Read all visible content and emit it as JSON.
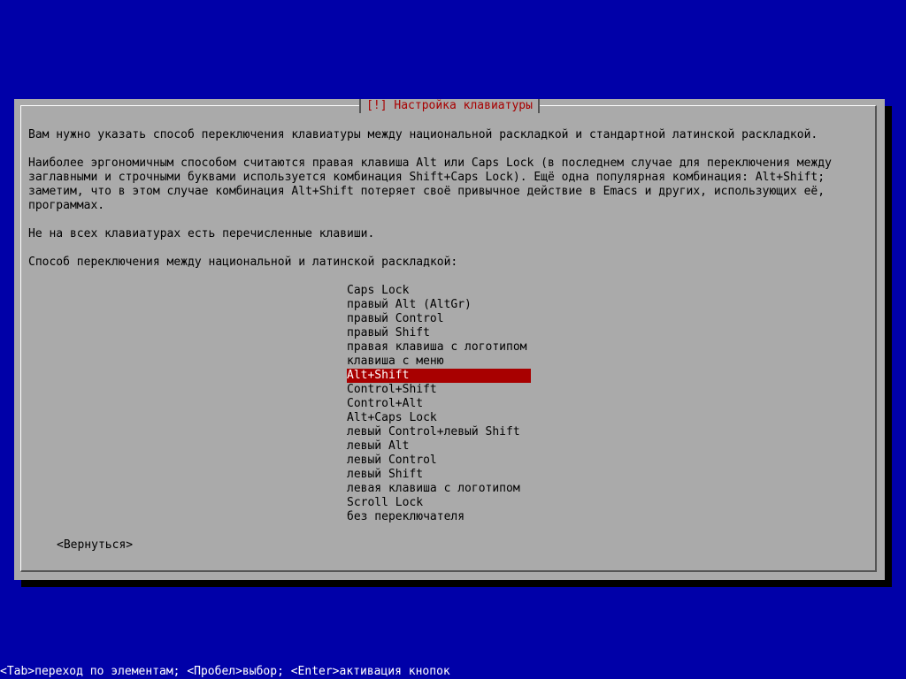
{
  "dialog": {
    "title": "[!] Настройка клавиатуры",
    "paragraph1": "Вам нужно указать способ переключения клавиатуры между национальной раскладкой и стандартной латинской раскладкой.",
    "paragraph2_line1": "Наиболее эргономичным способом считаются правая клавиша Alt или Caps Lock (в последнем случае для переключения между",
    "paragraph2_line2": "заглавными и строчными буквами используется комбинация Shift+Caps Lock). Ещё одна популярная комбинация: Alt+Shift;",
    "paragraph2_line3": "заметим, что в этом случае комбинация Alt+Shift потеряет своё привычное действие в Emacs и других, использующих её,",
    "paragraph2_line4": "программах.",
    "paragraph3": "Не на всех клавиатурах есть перечисленные клавиши.",
    "prompt": "Способ переключения между национальной и латинской раскладкой:",
    "options": [
      "Caps Lock",
      "правый Alt (AltGr)",
      "правый Control",
      "правый Shift",
      "правая клавиша с логотипом",
      "клавиша с меню",
      "Alt+Shift",
      "Control+Shift",
      "Control+Alt",
      "Alt+Caps Lock",
      "левый Control+левый Shift",
      "левый Alt",
      "левый Control",
      "левый Shift",
      "левая клавиша с логотипом",
      "Scroll Lock",
      "без переключателя"
    ],
    "selected_option": "Alt+Shift",
    "back_button_label": "<Вернуться>"
  },
  "statusbar": {
    "text": "<Tab>переход по элементам; <Пробел>выбор; <Enter>активация кнопок"
  },
  "colors": {
    "background": "#0000a8",
    "dialog": "#aaaaaa",
    "title": "#a80000",
    "selection": "#a80000",
    "selection_text": "#ffffff"
  }
}
